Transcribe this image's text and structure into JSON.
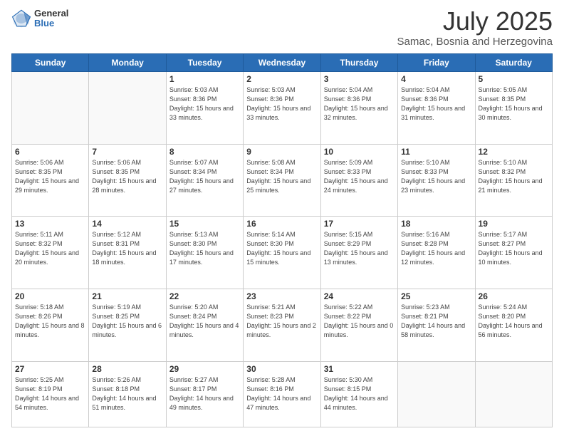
{
  "logo": {
    "general": "General",
    "blue": "Blue"
  },
  "header": {
    "month": "July 2025",
    "location": "Samac, Bosnia and Herzegovina"
  },
  "days_of_week": [
    "Sunday",
    "Monday",
    "Tuesday",
    "Wednesday",
    "Thursday",
    "Friday",
    "Saturday"
  ],
  "weeks": [
    [
      {
        "day": "",
        "info": ""
      },
      {
        "day": "",
        "info": ""
      },
      {
        "day": "1",
        "info": "Sunrise: 5:03 AM\nSunset: 8:36 PM\nDaylight: 15 hours and 33 minutes."
      },
      {
        "day": "2",
        "info": "Sunrise: 5:03 AM\nSunset: 8:36 PM\nDaylight: 15 hours and 33 minutes."
      },
      {
        "day": "3",
        "info": "Sunrise: 5:04 AM\nSunset: 8:36 PM\nDaylight: 15 hours and 32 minutes."
      },
      {
        "day": "4",
        "info": "Sunrise: 5:04 AM\nSunset: 8:36 PM\nDaylight: 15 hours and 31 minutes."
      },
      {
        "day": "5",
        "info": "Sunrise: 5:05 AM\nSunset: 8:35 PM\nDaylight: 15 hours and 30 minutes."
      }
    ],
    [
      {
        "day": "6",
        "info": "Sunrise: 5:06 AM\nSunset: 8:35 PM\nDaylight: 15 hours and 29 minutes."
      },
      {
        "day": "7",
        "info": "Sunrise: 5:06 AM\nSunset: 8:35 PM\nDaylight: 15 hours and 28 minutes."
      },
      {
        "day": "8",
        "info": "Sunrise: 5:07 AM\nSunset: 8:34 PM\nDaylight: 15 hours and 27 minutes."
      },
      {
        "day": "9",
        "info": "Sunrise: 5:08 AM\nSunset: 8:34 PM\nDaylight: 15 hours and 25 minutes."
      },
      {
        "day": "10",
        "info": "Sunrise: 5:09 AM\nSunset: 8:33 PM\nDaylight: 15 hours and 24 minutes."
      },
      {
        "day": "11",
        "info": "Sunrise: 5:10 AM\nSunset: 8:33 PM\nDaylight: 15 hours and 23 minutes."
      },
      {
        "day": "12",
        "info": "Sunrise: 5:10 AM\nSunset: 8:32 PM\nDaylight: 15 hours and 21 minutes."
      }
    ],
    [
      {
        "day": "13",
        "info": "Sunrise: 5:11 AM\nSunset: 8:32 PM\nDaylight: 15 hours and 20 minutes."
      },
      {
        "day": "14",
        "info": "Sunrise: 5:12 AM\nSunset: 8:31 PM\nDaylight: 15 hours and 18 minutes."
      },
      {
        "day": "15",
        "info": "Sunrise: 5:13 AM\nSunset: 8:30 PM\nDaylight: 15 hours and 17 minutes."
      },
      {
        "day": "16",
        "info": "Sunrise: 5:14 AM\nSunset: 8:30 PM\nDaylight: 15 hours and 15 minutes."
      },
      {
        "day": "17",
        "info": "Sunrise: 5:15 AM\nSunset: 8:29 PM\nDaylight: 15 hours and 13 minutes."
      },
      {
        "day": "18",
        "info": "Sunrise: 5:16 AM\nSunset: 8:28 PM\nDaylight: 15 hours and 12 minutes."
      },
      {
        "day": "19",
        "info": "Sunrise: 5:17 AM\nSunset: 8:27 PM\nDaylight: 15 hours and 10 minutes."
      }
    ],
    [
      {
        "day": "20",
        "info": "Sunrise: 5:18 AM\nSunset: 8:26 PM\nDaylight: 15 hours and 8 minutes."
      },
      {
        "day": "21",
        "info": "Sunrise: 5:19 AM\nSunset: 8:25 PM\nDaylight: 15 hours and 6 minutes."
      },
      {
        "day": "22",
        "info": "Sunrise: 5:20 AM\nSunset: 8:24 PM\nDaylight: 15 hours and 4 minutes."
      },
      {
        "day": "23",
        "info": "Sunrise: 5:21 AM\nSunset: 8:23 PM\nDaylight: 15 hours and 2 minutes."
      },
      {
        "day": "24",
        "info": "Sunrise: 5:22 AM\nSunset: 8:22 PM\nDaylight: 15 hours and 0 minutes."
      },
      {
        "day": "25",
        "info": "Sunrise: 5:23 AM\nSunset: 8:21 PM\nDaylight: 14 hours and 58 minutes."
      },
      {
        "day": "26",
        "info": "Sunrise: 5:24 AM\nSunset: 8:20 PM\nDaylight: 14 hours and 56 minutes."
      }
    ],
    [
      {
        "day": "27",
        "info": "Sunrise: 5:25 AM\nSunset: 8:19 PM\nDaylight: 14 hours and 54 minutes."
      },
      {
        "day": "28",
        "info": "Sunrise: 5:26 AM\nSunset: 8:18 PM\nDaylight: 14 hours and 51 minutes."
      },
      {
        "day": "29",
        "info": "Sunrise: 5:27 AM\nSunset: 8:17 PM\nDaylight: 14 hours and 49 minutes."
      },
      {
        "day": "30",
        "info": "Sunrise: 5:28 AM\nSunset: 8:16 PM\nDaylight: 14 hours and 47 minutes."
      },
      {
        "day": "31",
        "info": "Sunrise: 5:30 AM\nSunset: 8:15 PM\nDaylight: 14 hours and 44 minutes."
      },
      {
        "day": "",
        "info": ""
      },
      {
        "day": "",
        "info": ""
      }
    ]
  ]
}
